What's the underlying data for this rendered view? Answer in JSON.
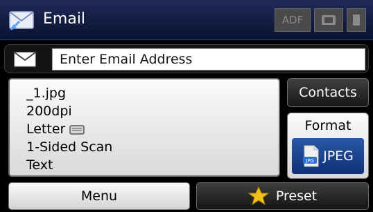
{
  "header": {
    "title": "Email",
    "status": {
      "adf_label": "ADF"
    }
  },
  "address": {
    "placeholder": "Enter Email Address"
  },
  "settings": {
    "filename": "_1.jpg",
    "resolution": "200dpi",
    "paper_size": "Letter",
    "sides": "1-Sided Scan",
    "doc_type": "Text"
  },
  "right_panel": {
    "contacts_label": "Contacts",
    "format_label": "Format",
    "format_value": "JPEG"
  },
  "bottom": {
    "menu_label": "Menu",
    "preset_label": "Preset"
  },
  "colors": {
    "header_bg": "#0a1230",
    "format_value_bg": "#0f3077",
    "star": "#f2c21c"
  },
  "icons": {
    "header": "email-icon",
    "address": "envelope-icon",
    "paper": "paper-icon",
    "format": "jpeg-file-icon",
    "preset": "star-icon",
    "adf": "adf-icon",
    "memory_card": "memory-card-icon",
    "document": "document-icon"
  }
}
